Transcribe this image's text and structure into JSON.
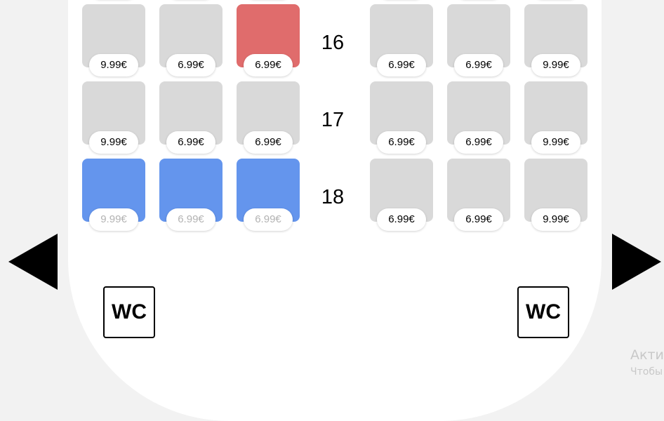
{
  "rows": [
    {
      "number": "",
      "seats": [
        {
          "price": "",
          "state": "available"
        },
        {
          "price": "",
          "state": "available"
        },
        {
          "price": "",
          "state": "available"
        },
        {
          "price": "",
          "state": "available"
        },
        {
          "price": "",
          "state": "available"
        },
        {
          "price": "",
          "state": "available"
        }
      ]
    },
    {
      "number": "16",
      "seats": [
        {
          "price": "9.99€",
          "state": "available"
        },
        {
          "price": "6.99€",
          "state": "available"
        },
        {
          "price": "6.99€",
          "state": "occupied"
        },
        {
          "price": "6.99€",
          "state": "available"
        },
        {
          "price": "6.99€",
          "state": "available"
        },
        {
          "price": "9.99€",
          "state": "available"
        }
      ]
    },
    {
      "number": "17",
      "seats": [
        {
          "price": "9.99€",
          "state": "available"
        },
        {
          "price": "6.99€",
          "state": "available"
        },
        {
          "price": "6.99€",
          "state": "available"
        },
        {
          "price": "6.99€",
          "state": "available"
        },
        {
          "price": "6.99€",
          "state": "available"
        },
        {
          "price": "9.99€",
          "state": "available"
        }
      ]
    },
    {
      "number": "18",
      "seats": [
        {
          "price": "9.99€",
          "state": "selected"
        },
        {
          "price": "6.99€",
          "state": "selected"
        },
        {
          "price": "6.99€",
          "state": "selected"
        },
        {
          "price": "6.99€",
          "state": "available"
        },
        {
          "price": "6.99€",
          "state": "available"
        },
        {
          "price": "9.99€",
          "state": "available"
        }
      ]
    }
  ],
  "wc_label": "WC",
  "arrows": {
    "left_icon": "triangle-left-icon",
    "right_icon": "triangle-right-icon"
  },
  "colors": {
    "seat_available": "#d9d9d9",
    "seat_occupied": "#e06c6c",
    "seat_selected": "#6495ed",
    "price_selected_text": "#b3b3b3"
  },
  "watermark": {
    "line1": "Актив",
    "line2": "Чтобы"
  }
}
